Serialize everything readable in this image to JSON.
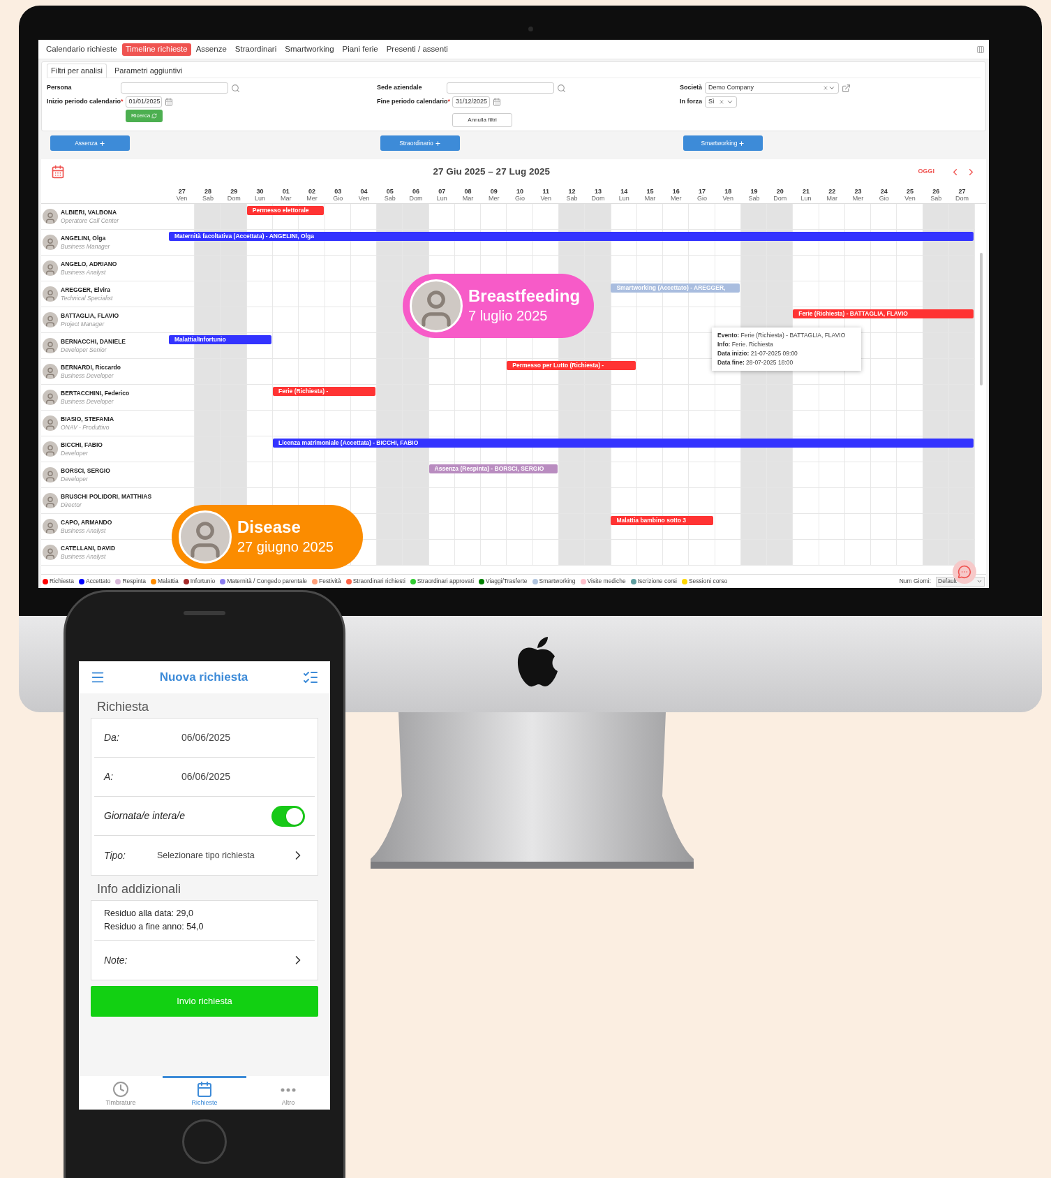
{
  "desktop": {
    "tabs": [
      {
        "label": "Calendario richieste",
        "selected": false
      },
      {
        "label": "Timeline richieste",
        "selected": true
      },
      {
        "label": "Assenze",
        "selected": false
      },
      {
        "label": "Straordinari",
        "selected": false
      },
      {
        "label": "Smartworking",
        "selected": false
      },
      {
        "label": "Piani ferie",
        "selected": false
      },
      {
        "label": "Presenti / assenti",
        "selected": false
      }
    ],
    "filter_tabs": [
      {
        "label": "Filtri per analisi",
        "selected": true
      },
      {
        "label": "Parametri aggiuntivi",
        "selected": false
      }
    ],
    "filters": {
      "persona": {
        "label": "Persona"
      },
      "inizio": {
        "label": "Inizio periodo calendario",
        "required_mark": "*",
        "value": "01/01/2025"
      },
      "ricerca_button": "Ricerca",
      "sede": {
        "label": "Sede aziendale"
      },
      "fine": {
        "label": "Fine periodo calendario",
        "required_mark": "*",
        "value": "31/12/2025"
      },
      "annulla_button": "Annulla filtri",
      "societa": {
        "label": "Società",
        "value": "Demo Company"
      },
      "in_forza": {
        "label": "In forza",
        "value": "Sì"
      }
    },
    "action_buttons": [
      "Assenza",
      "Straordinario",
      "Smartworking"
    ],
    "calendar": {
      "title": "27 Giu 2025 – 27 Lug 2025",
      "today_button": "OGGI",
      "days": [
        {
          "num": "27",
          "name": "Ven",
          "weekend": false
        },
        {
          "num": "28",
          "name": "Sab",
          "weekend": true
        },
        {
          "num": "29",
          "name": "Dom",
          "weekend": true
        },
        {
          "num": "30",
          "name": "Lun",
          "weekend": false
        },
        {
          "num": "01",
          "name": "Mar",
          "weekend": false
        },
        {
          "num": "02",
          "name": "Mer",
          "weekend": false
        },
        {
          "num": "03",
          "name": "Gio",
          "weekend": false
        },
        {
          "num": "04",
          "name": "Ven",
          "weekend": false
        },
        {
          "num": "05",
          "name": "Sab",
          "weekend": true
        },
        {
          "num": "06",
          "name": "Dom",
          "weekend": true
        },
        {
          "num": "07",
          "name": "Lun",
          "weekend": false
        },
        {
          "num": "08",
          "name": "Mar",
          "weekend": false
        },
        {
          "num": "09",
          "name": "Mer",
          "weekend": false
        },
        {
          "num": "10",
          "name": "Gio",
          "weekend": false
        },
        {
          "num": "11",
          "name": "Ven",
          "weekend": false
        },
        {
          "num": "12",
          "name": "Sab",
          "weekend": true
        },
        {
          "num": "13",
          "name": "Dom",
          "weekend": true
        },
        {
          "num": "14",
          "name": "Lun",
          "weekend": false
        },
        {
          "num": "15",
          "name": "Mar",
          "weekend": false
        },
        {
          "num": "16",
          "name": "Mer",
          "weekend": false
        },
        {
          "num": "17",
          "name": "Gio",
          "weekend": false
        },
        {
          "num": "18",
          "name": "Ven",
          "weekend": false
        },
        {
          "num": "19",
          "name": "Sab",
          "weekend": true
        },
        {
          "num": "20",
          "name": "Dom",
          "weekend": true
        },
        {
          "num": "21",
          "name": "Lun",
          "weekend": false
        },
        {
          "num": "22",
          "name": "Mar",
          "weekend": false
        },
        {
          "num": "23",
          "name": "Mer",
          "weekend": false
        },
        {
          "num": "24",
          "name": "Gio",
          "weekend": false
        },
        {
          "num": "25",
          "name": "Ven",
          "weekend": false
        },
        {
          "num": "26",
          "name": "Sab",
          "weekend": true
        },
        {
          "num": "27",
          "name": "Dom",
          "weekend": true
        }
      ],
      "people": [
        {
          "name": "ALBIERI, VALBONA",
          "role": "Operatore Call Center",
          "events": [
            {
              "label": "Permesso elettorale",
              "color": "#ff3333"
            }
          ]
        },
        {
          "name": "ANGELINI, Olga",
          "role": "Business Manager",
          "events": [
            {
              "label": "Maternità facoltativa (Accettata) - ANGELINI, Olga",
              "color": "#3333ff"
            }
          ]
        },
        {
          "name": "ANGELO, ADRIANO",
          "role": "Business Analyst"
        },
        {
          "name": "AREGGER, Elvira",
          "role": "Technical Specialist",
          "events": [
            {
              "label": "Smartworking (Accettato) - AREGGER,",
              "color": "#a9bddf"
            }
          ]
        },
        {
          "name": "BATTAGLIA, FLAVIO",
          "role": "Project Manager",
          "events": [
            {
              "label": "Ferie (Richiesta) - BATTAGLIA, FLAVIO",
              "color": "#ff3333"
            }
          ]
        },
        {
          "name": "BERNACCHI, DANIELE",
          "role": "Developer Senior",
          "events": [
            {
              "label": "Malattia/Infortunio",
              "color": "#3333ff"
            }
          ]
        },
        {
          "name": "BERNARDI, Riccardo",
          "role": "Business Developer",
          "events": [
            {
              "label": "Permesso per Lutto (Richiesta) -",
              "color": "#ff3333"
            }
          ]
        },
        {
          "name": "BERTACCHINI, Federico",
          "role": "Business Developer",
          "events": [
            {
              "label": "Ferie (Richiesta) -",
              "color": "#ff3333"
            }
          ]
        },
        {
          "name": "BIASIO, STEFANIA",
          "role": "ONAV - Produttivo"
        },
        {
          "name": "BICCHI, FABIO",
          "role": "Developer",
          "events": [
            {
              "label": "Licenza matrimoniale (Accettata) - BICCHI, FABIO",
              "color": "#3333ff"
            }
          ]
        },
        {
          "name": "BORSCI, SERGIO",
          "role": "Developer",
          "events": [
            {
              "label": "Assenza (Respinta) - BORSCI, SERGIO",
              "color": "#b98cc0"
            }
          ]
        },
        {
          "name": "BRUSCHI POLIDORI, MATTHIAS",
          "role": "Director"
        },
        {
          "name": "CAPO, ARMANDO",
          "role": "Business Analyst",
          "events": [
            {
              "label": "Malattia bambino sotto 3",
              "color": "#ff3333"
            }
          ]
        },
        {
          "name": "CATELLANI, DAVID",
          "role": "Business Analyst"
        }
      ],
      "tooltip": [
        {
          "key": "Evento:",
          "value": "Ferie (Richiesta) - BATTAGLIA, FLAVIO"
        },
        {
          "key": "Info:",
          "value": "Ferie. Richiesta"
        },
        {
          "key": "Data inizio:",
          "value": "21-07-2025 09:00"
        },
        {
          "key": "Data fine:",
          "value": "28-07-2025 18:00"
        }
      ],
      "legend": [
        {
          "label": "Richiesta",
          "color": "#ff0000"
        },
        {
          "label": "Accettato",
          "color": "#0000ff"
        },
        {
          "label": "Respinta",
          "color": "#d8b8d8"
        },
        {
          "label": "Malattia",
          "color": "#ff8c00"
        },
        {
          "label": "Infortunio",
          "color": "#a52a2a"
        },
        {
          "label": "Maternità / Congedo parentale",
          "color": "#8a7cf0"
        },
        {
          "label": "Festività",
          "color": "#ffa07a"
        },
        {
          "label": "Straordinari richiesti",
          "color": "#ff6347"
        },
        {
          "label": "Straordinari approvati",
          "color": "#32cd32"
        },
        {
          "label": "Viaggi/Trasferte",
          "color": "#008000"
        },
        {
          "label": "Smartworking",
          "color": "#b0c4de"
        },
        {
          "label": "Visite mediche",
          "color": "#ffc0cb"
        },
        {
          "label": "Iscrizione corsi",
          "color": "#5f9ea0"
        },
        {
          "label": "Sessioni corso",
          "color": "#ffd700"
        }
      ],
      "num_giorni": {
        "label": "Num Giorni:",
        "value": "Default"
      }
    },
    "callouts": [
      {
        "title": "Breastfeeding",
        "date": "7 luglio 2025",
        "color": "#f75bc8"
      },
      {
        "title": "Disease",
        "date": "27 giugno 2025",
        "color": "#fb8c00"
      }
    ]
  },
  "phone": {
    "title": "Nuova richiesta",
    "section_1": "Richiesta",
    "da": {
      "label": "Da:",
      "value": "06/06/2025"
    },
    "a": {
      "label": "A:",
      "value": "06/06/2025"
    },
    "giornata": {
      "label": "Giornata/e intera/e",
      "on": true
    },
    "tipo": {
      "label": "Tipo:",
      "placeholder": "Selezionare tipo richiesta"
    },
    "section_2": "Info addizionali",
    "info_lines": [
      "Residuo alla data: 29,0",
      "Residuo a fine anno: 54,0"
    ],
    "note": {
      "label": "Note:"
    },
    "submit": "Invio richiesta",
    "nav": [
      {
        "label": "Timbrature",
        "kind": "clock",
        "selected": false
      },
      {
        "label": "Richieste",
        "kind": "calendar",
        "selected": true
      },
      {
        "label": "Altro",
        "kind": "more",
        "selected": false
      }
    ]
  }
}
